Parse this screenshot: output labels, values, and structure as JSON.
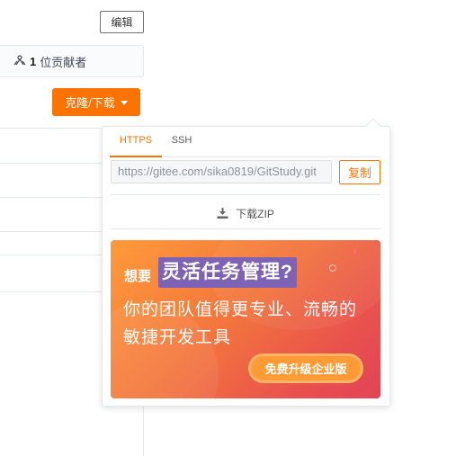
{
  "header": {
    "edit_label": "编辑",
    "contributors_count": "1",
    "contributors_label": "位贡献者",
    "clone_label": "克隆/下载"
  },
  "clone_popover": {
    "tabs": [
      {
        "label": "HTTPS",
        "active": true
      },
      {
        "label": "SSH",
        "active": false
      }
    ],
    "url": "https://gitee.com/sika0819/GitStudy.git",
    "copy_label": "复制",
    "download_zip_label": "下载ZIP",
    "accent_color": "#fe7300"
  },
  "promo": {
    "want_label": "想要",
    "highlight": "灵活任务管理?",
    "line1": "你的团队值得更专业、流畅的",
    "line2": "敏捷开发工具",
    "button_label": "免费升级企业版",
    "plus_icon": "+"
  }
}
